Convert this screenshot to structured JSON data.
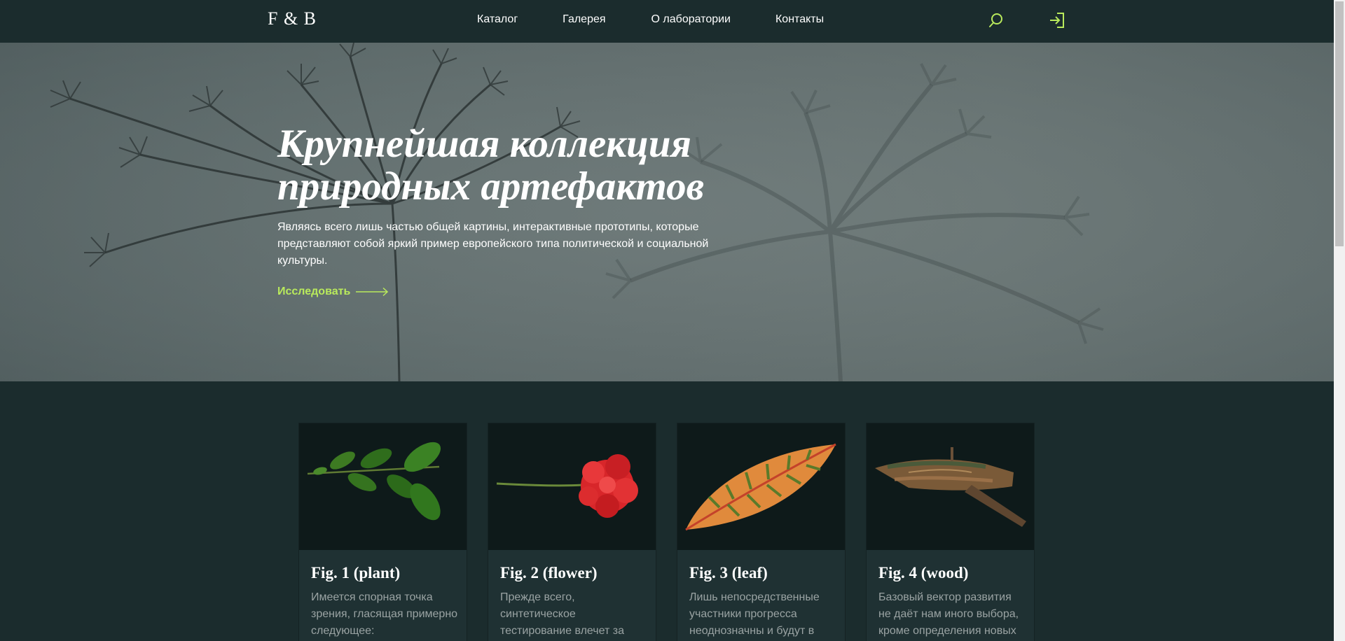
{
  "header": {
    "logo": "F & B",
    "nav": [
      "Каталог",
      "Галерея",
      "О лаборатории",
      "Контакты"
    ],
    "search_icon": "search-icon",
    "login_icon": "login-icon",
    "accent_color": "#b9ea5c"
  },
  "hero": {
    "title_line1": "Крупнейшая коллекция",
    "title_line2": "природных артефактов",
    "text": "Являясь всего лишь частью общей картины, интерактивные прототипы, которые представляют собой яркий пример европейского типа политической и социальной культуры.",
    "cta": "Исследовать"
  },
  "cards": [
    {
      "title": "Fig. 1 (plant)",
      "text": "Имеется спорная точка зрения, гласящая примерно следующее:"
    },
    {
      "title": "Fig. 2 (flower)",
      "text": "Прежде всего, синтетическое тестирование влечет за"
    },
    {
      "title": "Fig. 3 (leaf)",
      "text": "Лишь непосредственные участники прогресса неоднозначны и будут в"
    },
    {
      "title": "Fig. 4 (wood)",
      "text": "Базовый вектор развития не даёт нам иного выбора, кроме определения новых"
    }
  ]
}
